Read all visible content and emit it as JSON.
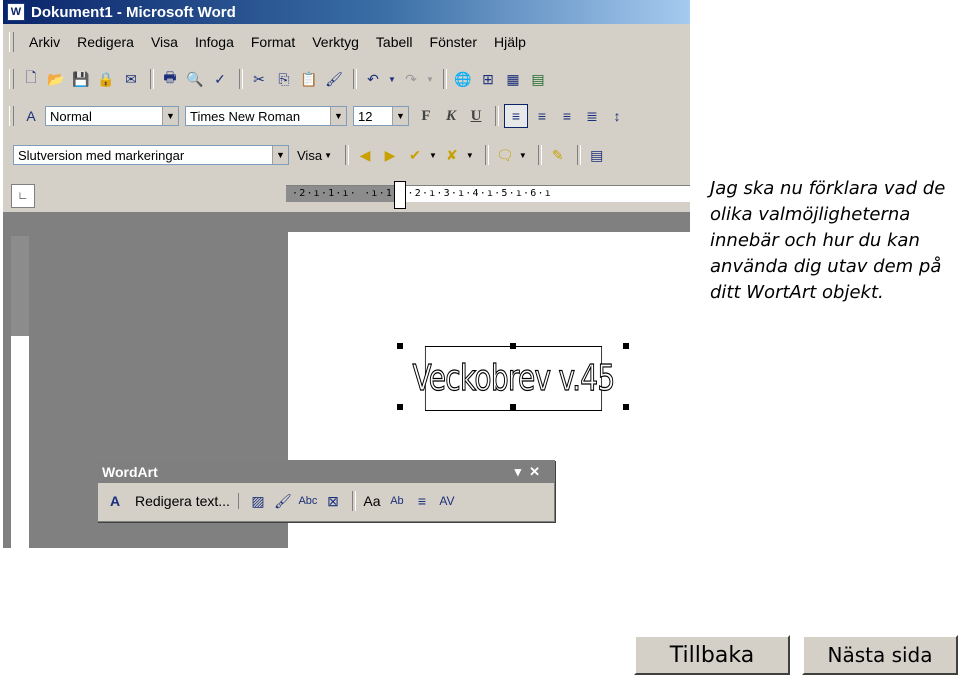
{
  "window": {
    "title": "Dokument1 - Microsoft Word"
  },
  "menu": [
    "Arkiv",
    "Redigera",
    "Visa",
    "Infoga",
    "Format",
    "Verktyg",
    "Tabell",
    "Fönster",
    "Hjälp"
  ],
  "formatting": {
    "style": "Normal",
    "font": "Times New Roman",
    "size": "12",
    "bold": "F",
    "italic": "K",
    "underline": "U"
  },
  "review": {
    "markup_mode": "Slutversion med markeringar",
    "show": "Visa"
  },
  "ruler": {
    "ticks": "·2·ı·1·ı·  ·ı·1·ı·2·ı·3·ı·4·ı·5·ı·6·ı"
  },
  "document": {
    "wordart_text": "Veckobrev v.45"
  },
  "wordart_toolbar": {
    "title": "WordArt",
    "edit_text": "Redigera text..."
  },
  "explanation": "Jag ska nu förklara vad de olika valmöjligheterna innebär och hur du kan använda dig utav dem på ditt WortArt objekt.",
  "nav": {
    "back": "Tillbaka",
    "next": "Nästa sida"
  }
}
